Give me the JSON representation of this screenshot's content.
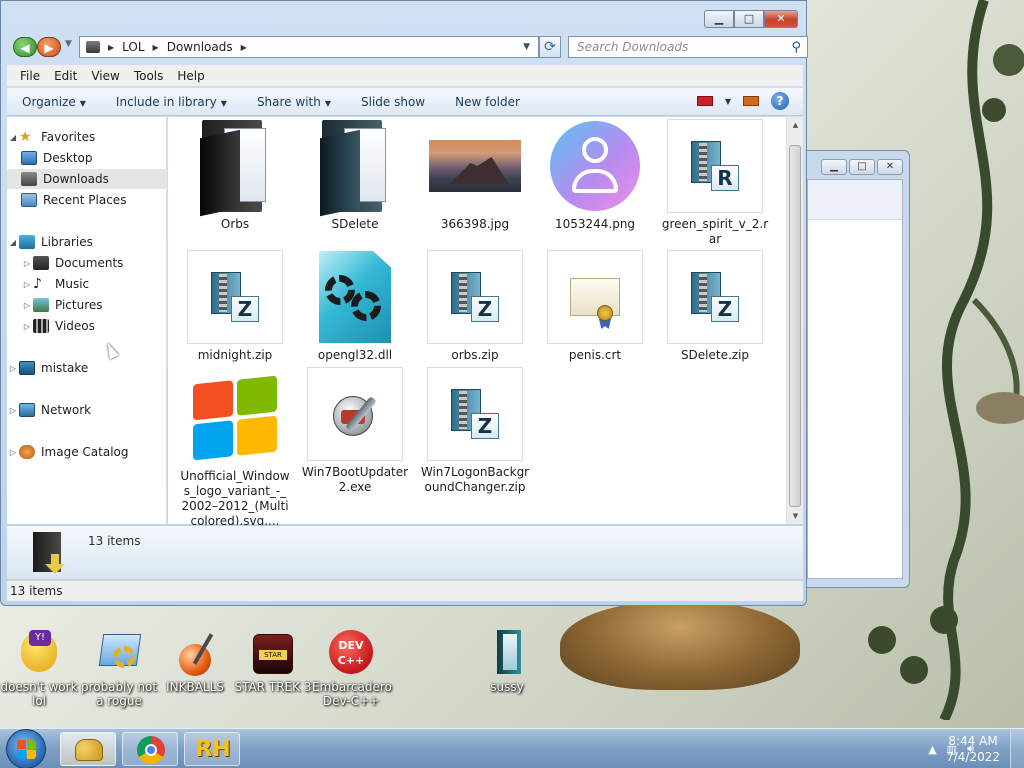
{
  "window": {
    "minimize_glyph": "▁",
    "maximize_glyph": "□",
    "close_glyph": "✕"
  },
  "address": {
    "crumbs": [
      "LOL",
      "Downloads"
    ],
    "search_placeholder": "Search Downloads"
  },
  "menu": [
    "File",
    "Edit",
    "View",
    "Tools",
    "Help"
  ],
  "commands": {
    "organize": "Organize",
    "include_in_library": "Include in library",
    "share_with": "Share with",
    "slide_show": "Slide show",
    "new_folder": "New folder",
    "help": "?"
  },
  "nav": {
    "favorites": "Favorites",
    "desktop": "Desktop",
    "downloads": "Downloads",
    "recent_places": "Recent Places",
    "libraries": "Libraries",
    "documents": "Documents",
    "music": "Music",
    "pictures": "Pictures",
    "videos": "Videos",
    "mistake": "mistake",
    "network": "Network",
    "image_catalog": "Image Catalog"
  },
  "files": [
    {
      "name": "Orbs"
    },
    {
      "name": "SDelete"
    },
    {
      "name": "366398.jpg"
    },
    {
      "name": "1053244.png"
    },
    {
      "name": "green_spirit_v_2.rar"
    },
    {
      "name": "midnight.zip"
    },
    {
      "name": "opengl32.dll"
    },
    {
      "name": "orbs.zip"
    },
    {
      "name": "penis.crt"
    },
    {
      "name": "SDelete.zip"
    },
    {
      "name": "Unofficial_Windows_logo_variant_-_2002–2012_(Multicolored).svg...."
    },
    {
      "name": "Win7BootUpdater2.exe"
    },
    {
      "name": "Win7LogonBackgroundChanger.zip"
    }
  ],
  "details": {
    "count": "13 items"
  },
  "status": {
    "count": "13 items"
  },
  "desktop_icons": [
    {
      "label": "doesn't work lol"
    },
    {
      "label": "probably not a rogue"
    },
    {
      "label": "INKBALLS"
    },
    {
      "label": "STAR TREK 3"
    },
    {
      "label": "Embarcadero Dev-C++"
    },
    {
      "label": "sussy"
    }
  ],
  "clock": {
    "time": "8:44 AM",
    "date": "7/4/2022"
  },
  "colors": {
    "accent": "#2f6fb8",
    "close": "#c4422b"
  }
}
